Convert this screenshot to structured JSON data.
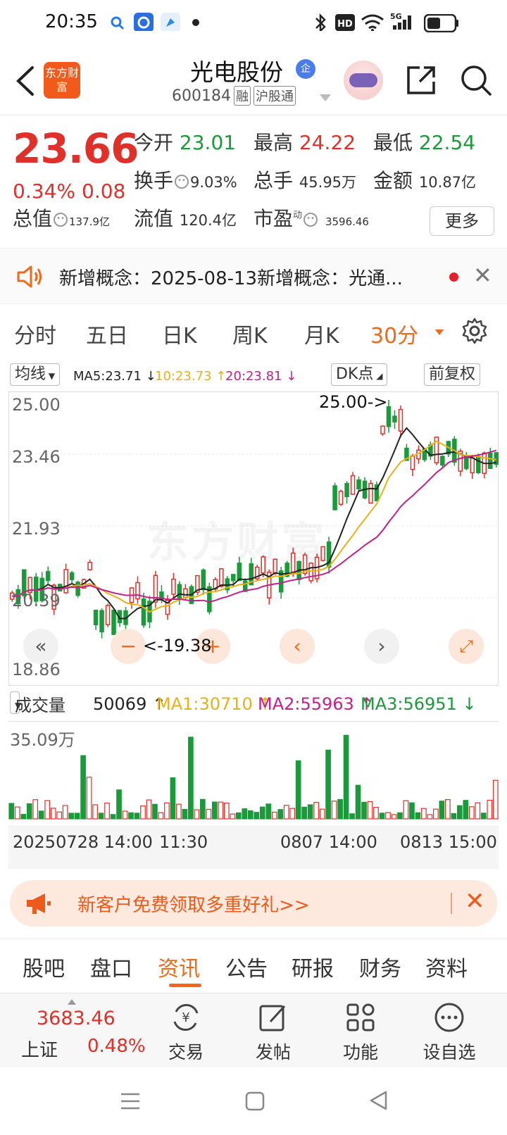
{
  "status_bar": {
    "time": "20:35",
    "network": "5G",
    "hd": "HD"
  },
  "header": {
    "logo_text": "东方财富",
    "stock_name": "光电股份",
    "badge": "企",
    "stock_code": "600184",
    "tags": [
      "融",
      "沪股通"
    ]
  },
  "quote": {
    "price": "23.66",
    "change_pct": "0.34%",
    "change": "0.08",
    "rows": [
      {
        "label": "今开",
        "value": "23.01",
        "color": "green"
      },
      {
        "label": "最高",
        "value": "24.22",
        "color": "red"
      },
      {
        "label": "最低",
        "value": "22.54",
        "color": "green"
      },
      {
        "label": "换手",
        "value": "9.03%"
      },
      {
        "label": "总手",
        "value": "45.95万"
      },
      {
        "label": "金额",
        "value": "10.87亿"
      },
      {
        "label": "总值",
        "value": "137.9亿"
      },
      {
        "label": "流值",
        "value": "120.4亿"
      },
      {
        "label": "市盈",
        "sup": "动",
        "value": "3596.46"
      }
    ],
    "more_label": "更多"
  },
  "news_strip": {
    "text": "新增概念：2025-08-13新增概念：光通..."
  },
  "period_tabs": [
    "分时",
    "五日",
    "日K",
    "周K",
    "月K",
    "30分"
  ],
  "active_period": "30分",
  "ma_row": {
    "selector": "均线",
    "ma5": "MA5:23.71 ↓",
    "ma10": "10:23.73 ↑",
    "ma20": "20:23.81 ↓",
    "dk": "DK点",
    "adjust": "前复权"
  },
  "kline": {
    "y_labels": [
      "25.00",
      "23.46",
      "21.93",
      "20.39",
      "18.86"
    ],
    "high_marker": "25.00->",
    "low_marker": "<-19.38",
    "watermark": "东方财富"
  },
  "volume": {
    "selector": "成交量",
    "current": "50069 ↑",
    "ma1": "MA1:30710 ↑",
    "ma2": "MA2:55963 ↑",
    "ma3": "MA3:56951 ↓",
    "max_label": "35.09万"
  },
  "date_axis": [
    "20250728 14:00",
    "11:30",
    "0807 14:00",
    "0813 15:00"
  ],
  "promo": {
    "text": "新客户免费领取多重好礼>>"
  },
  "bottom_tabs": [
    "股吧",
    "盘口",
    "资讯",
    "公告",
    "研报",
    "财务",
    "资料"
  ],
  "active_bottom_tab": "资讯",
  "index": {
    "value": "3683.46",
    "name": "上证",
    "pct": "0.48%"
  },
  "bottom_nav": [
    "交易",
    "发帖",
    "功能",
    "设自选"
  ],
  "colors": {
    "up": "#e0302a",
    "down": "#1a9a3a",
    "accent": "#ee6a1a",
    "ma5": "#222222",
    "ma10": "#e5b218",
    "ma20": "#c0218c"
  }
}
